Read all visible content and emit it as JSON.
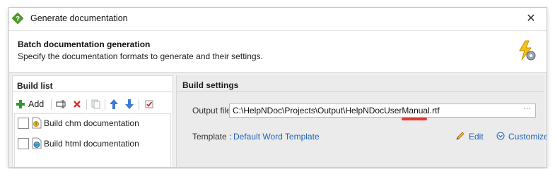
{
  "window": {
    "title": "Generate documentation",
    "close_glyph": "✕"
  },
  "header": {
    "title": "Batch documentation generation",
    "subtitle": "Specify the documentation formats to generate and their settings.",
    "icon": "lightning-gear-icon"
  },
  "build_list": {
    "heading": "Build list",
    "toolbar": {
      "add_label": "Add",
      "add_icon": "plus-icon",
      "rename_icon": "rename-icon",
      "delete_icon": "delete-x-icon",
      "copy_icon": "copy-icon",
      "move_up_icon": "arrow-up-icon",
      "move_down_icon": "arrow-down-icon",
      "check_all_icon": "checkbox-checked-icon"
    },
    "items": [
      {
        "label": "Build chm documentation",
        "icon": "chm-file-icon",
        "checked": false
      },
      {
        "label": "Build html documentation",
        "icon": "html-file-icon",
        "checked": false
      }
    ]
  },
  "build_settings": {
    "heading": "Build settings",
    "output_file_label": "Output file :",
    "output_file_value": "C:\\HelpNDoc\\Projects\\Output\\HelpNDocUserManual.rtf",
    "browse_glyph": "···",
    "template_label": "Template :",
    "template_value": "Default Word Template",
    "edit_label": "Edit",
    "customize_label": "Customize"
  },
  "colors": {
    "link": "#1f63b5",
    "accent_red": "#e53935",
    "add_green": "#2e9a2e",
    "arrow_blue": "#3a7bd5"
  }
}
